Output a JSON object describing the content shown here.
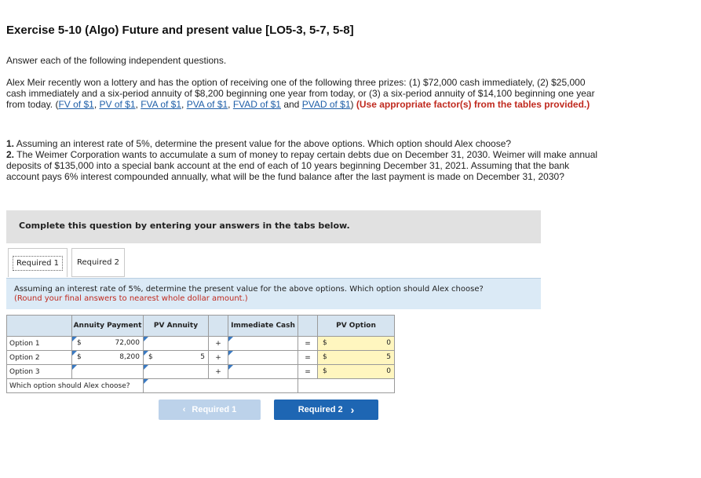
{
  "title": "Exercise 5-10 (Algo) Future and present value [LO5-3, 5-7, 5-8]",
  "intro": "Answer each of the following independent questions.",
  "scenario": {
    "text": "Alex Meir recently won a lottery and has the option of receiving one of the following three prizes: (1) $72,000 cash immediately, (2) $25,000 cash immediately and a six-period annuity of $8,200 beginning one year from today, or (3) a six-period annuity of $14,100 beginning one year from today. (",
    "links": [
      "FV of $1",
      "PV of $1",
      "FVA of $1",
      "PVA of $1",
      "FVAD of $1",
      "PVAD of $1"
    ],
    "and_word": "and",
    "close_paren": ")",
    "instruction": "(Use appropriate factor(s) from the tables provided.)"
  },
  "questions": {
    "q1_num": "1.",
    "q1": "Assuming an interest rate of 5%, determine the present value for the above options. Which option should Alex choose?",
    "q2_num": "2.",
    "q2": "The Weimer Corporation wants to accumulate a sum of money to repay certain debts due on December 31, 2030. Weimer will make annual deposits of $135,000 into a special bank account at the end of each of 10 years beginning December 31, 2021. Assuming that the bank account pays 6% interest compounded annually, what will be the fund balance after the last payment is made on December 31, 2030?"
  },
  "complete_banner": "Complete this question by entering your answers in the tabs below.",
  "tabs": [
    {
      "label": "Required 1"
    },
    {
      "label": "Required 2"
    }
  ],
  "instruction_box": {
    "text": "Assuming an interest rate of 5%, determine the present value for the above options. Which option should Alex choose?",
    "hint": "(Round your final answers to nearest whole dollar amount.)"
  },
  "table": {
    "headers": {
      "annuity_payment": "Annuity Payment",
      "pv_annuity": "PV Annuity",
      "immediate_cash": "Immediate Cash",
      "pv_option": "PV Option"
    },
    "rows": [
      {
        "label": "Option 1",
        "pay_sym": "$",
        "payment": "72,000",
        "pva_sym": "",
        "pva": "",
        "plus": "+",
        "cash": "",
        "eq": "=",
        "pv_sym": "$",
        "pv": "0"
      },
      {
        "label": "Option 2",
        "pay_sym": "$",
        "payment": "8,200",
        "pva_sym": "$",
        "pva": "5",
        "plus": "+",
        "cash": "",
        "eq": "=",
        "pv_sym": "$",
        "pv": "5"
      },
      {
        "label": "Option 3",
        "pay_sym": "",
        "payment": "",
        "pva_sym": "",
        "pva": "",
        "plus": "+",
        "cash": "",
        "eq": "=",
        "pv_sym": "$",
        "pv": "0"
      }
    ],
    "choice_label": "Which option should Alex choose?",
    "choice_value": ""
  },
  "nav": {
    "prev_chevron": "‹",
    "prev_label": "Required 1",
    "next_label": "Required 2",
    "next_chevron": "›"
  }
}
